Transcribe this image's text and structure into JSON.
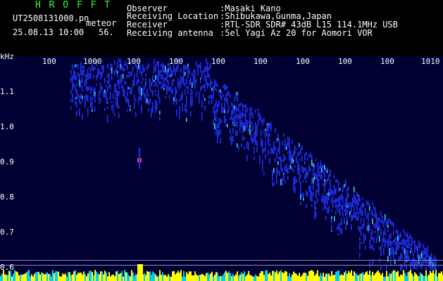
{
  "header": {
    "brand": "H R O F F T",
    "filename": "UT2508131000.pn",
    "mode": "meteor",
    "datetime": "25.08.13 10:00",
    "counter": "56.",
    "labels": [
      "Observer",
      "Receiving Location",
      "Receiver",
      "Receiving antenna"
    ],
    "values": [
      ":Masaki Kano",
      ":Shibukawa,Gunma,Japan",
      ":RTL-SDR SDR# 43dB L15 114.1MHz USB",
      ":5el Yagi Az 20 for Aomori VOR"
    ]
  },
  "chart_data": {
    "type": "heatmap",
    "ylabel": "kHz",
    "yticks": [
      "1.1",
      "1.0",
      "0.9",
      "0.8",
      "0.7",
      "0.6"
    ],
    "xticks": [
      "100",
      "1000",
      "100",
      "100",
      "100",
      "100",
      "100",
      "100",
      "100",
      "1010"
    ],
    "colors": {
      "background": "#000033",
      "signal_low": "#2233ff",
      "signal_mid": "#33ddff",
      "signal_high": "#ffff00",
      "meteor_ping": "#ff3366",
      "axis_text": "#ffffff",
      "title": "#33ff33"
    }
  }
}
